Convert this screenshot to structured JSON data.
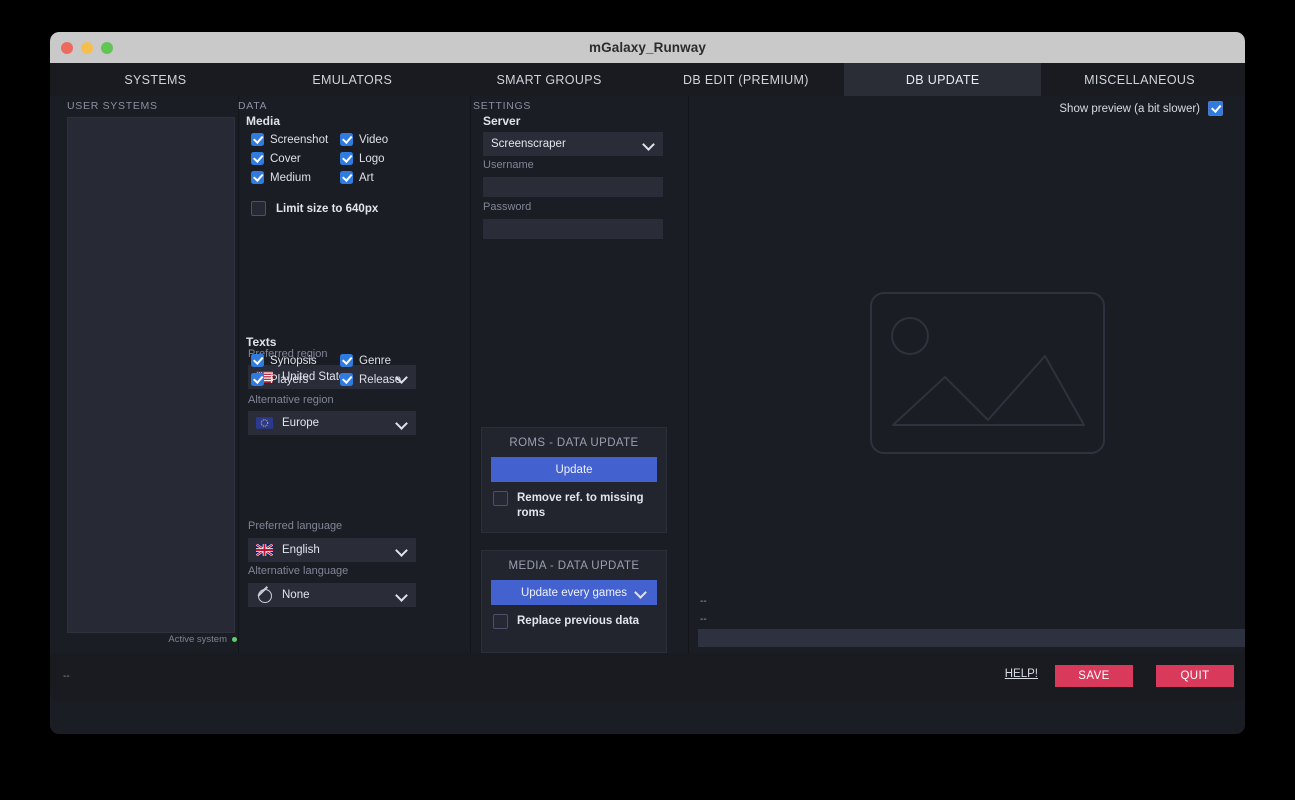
{
  "window": {
    "title": "mGalaxy_Runway",
    "traffic_lights": [
      "close",
      "minimize",
      "maximize"
    ]
  },
  "tabs": [
    {
      "label": "SYSTEMS",
      "active": false
    },
    {
      "label": "EMULATORS",
      "active": false
    },
    {
      "label": "SMART GROUPS",
      "active": false
    },
    {
      "label": "DB EDIT (PREMIUM)",
      "active": false
    },
    {
      "label": "DB UPDATE",
      "active": true
    },
    {
      "label": "MISCELLANEOUS",
      "active": false
    }
  ],
  "user_systems": {
    "heading": "USER SYSTEMS",
    "items": [],
    "active_system_label": "Active system"
  },
  "data_panel": {
    "heading": "DATA",
    "media": {
      "heading": "Media",
      "checkboxes": [
        {
          "label": "Screenshot",
          "checked": true
        },
        {
          "label": "Video",
          "checked": true
        },
        {
          "label": "Cover",
          "checked": true
        },
        {
          "label": "Logo",
          "checked": true
        },
        {
          "label": "Medium",
          "checked": true
        },
        {
          "label": "Art",
          "checked": true
        }
      ],
      "limit_size": {
        "label": "Limit size to 640px",
        "checked": false
      }
    },
    "preferred_region": {
      "label": "Preferred region",
      "value": "United States",
      "flag": "us-flag"
    },
    "alternative_region": {
      "label": "Alternative region",
      "value": "Europe",
      "flag": "eu-flag"
    },
    "texts": {
      "heading": "Texts",
      "checkboxes": [
        {
          "label": "Synopsis",
          "checked": true
        },
        {
          "label": "Genre",
          "checked": true
        },
        {
          "label": "Players",
          "checked": true
        },
        {
          "label": "Release",
          "checked": true
        }
      ]
    },
    "preferred_language": {
      "label": "Preferred language",
      "value": "English",
      "flag": "uk-flag"
    },
    "alternative_language": {
      "label": "Alternative language",
      "value": "None",
      "flag": "none-icon"
    }
  },
  "settings_panel": {
    "heading": "SETTINGS",
    "server": {
      "label": "Server",
      "value": "Screenscraper"
    },
    "username": {
      "label": "Username",
      "value": "",
      "placeholder": ""
    },
    "password": {
      "label": "Password",
      "value": "",
      "placeholder": ""
    },
    "roms_group": {
      "title": "ROMS - DATA UPDATE",
      "update_button": "Update",
      "remove_missing": {
        "label": "Remove ref. to missing roms",
        "checked": false
      }
    },
    "media_group": {
      "title": "MEDIA - DATA UPDATE",
      "update_select": "Update every games",
      "replace_previous": {
        "label": "Replace previous data",
        "checked": false
      }
    }
  },
  "preview_panel": {
    "show_preview": {
      "label": "Show preview (a bit slower)",
      "checked": true
    },
    "placeholder_icon": "image-placeholder-icon",
    "status_line_1": "--",
    "status_line_2": "--",
    "progress_percent": 0
  },
  "footer": {
    "status": "--",
    "help_label": "HELP!",
    "save_label": "SAVE",
    "quit_label": "QUIT"
  },
  "colors": {
    "accent_blue": "#4362d0",
    "checkbox_blue": "#2f7be0",
    "danger_red": "#d93a5c",
    "active_dot_green": "#5fcf6e",
    "window_bg": "#1b1d24",
    "panel_bg": "#22252e",
    "input_bg": "#2a2d38"
  }
}
